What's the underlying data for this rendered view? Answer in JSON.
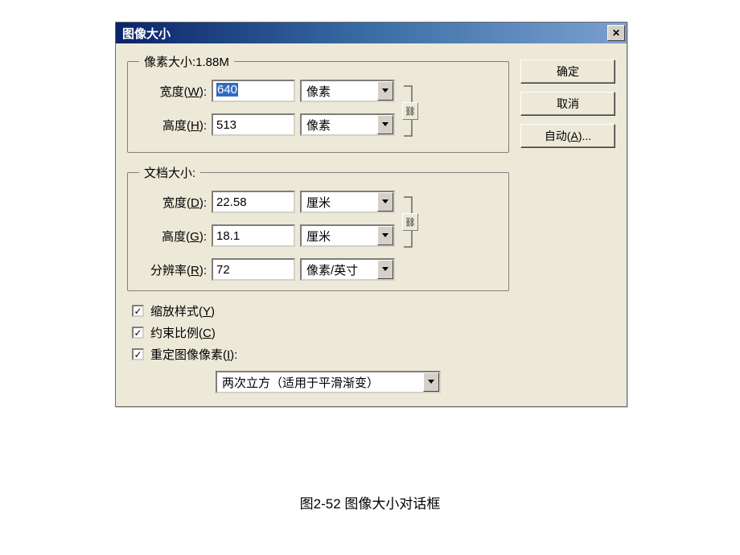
{
  "dialog": {
    "title": "图像大小",
    "close_glyph": "✕"
  },
  "pixel_group": {
    "legend": "像素大小:1.88M",
    "width_label_pre": "宽度(",
    "width_key": "W",
    "width_label_post": "):",
    "width_value": "640",
    "width_unit": "像素",
    "height_label_pre": "高度(",
    "height_key": "H",
    "height_label_post": "):",
    "height_value": "513",
    "height_unit": "像素"
  },
  "doc_group": {
    "legend": "文档大小:",
    "width_label_pre": "宽度(",
    "width_key": "D",
    "width_label_post": "):",
    "width_value": "22.58",
    "width_unit": "厘米",
    "height_label_pre": "高度(",
    "height_key": "G",
    "height_label_post": "):",
    "height_value": "18.1",
    "height_unit": "厘米",
    "res_label_pre": "分辨率(",
    "res_key": "R",
    "res_label_post": "):",
    "res_value": "72",
    "res_unit": "像素/英寸"
  },
  "checkboxes": {
    "scale_styles": "缩放样式(",
    "scale_styles_key": "Y",
    "scale_styles_post": ")",
    "constrain": "约束比例(",
    "constrain_key": "C",
    "constrain_post": ")",
    "resample": "重定图像像素(",
    "resample_key": "I",
    "resample_post": "):"
  },
  "resample_method": "两次立方（适用于平滑渐变）",
  "buttons": {
    "ok": "确定",
    "cancel": "取消",
    "auto_pre": "自动(",
    "auto_key": "A",
    "auto_post": ")..."
  },
  "chain_glyph": "⛓",
  "caption": "图2-52 图像大小对话框"
}
